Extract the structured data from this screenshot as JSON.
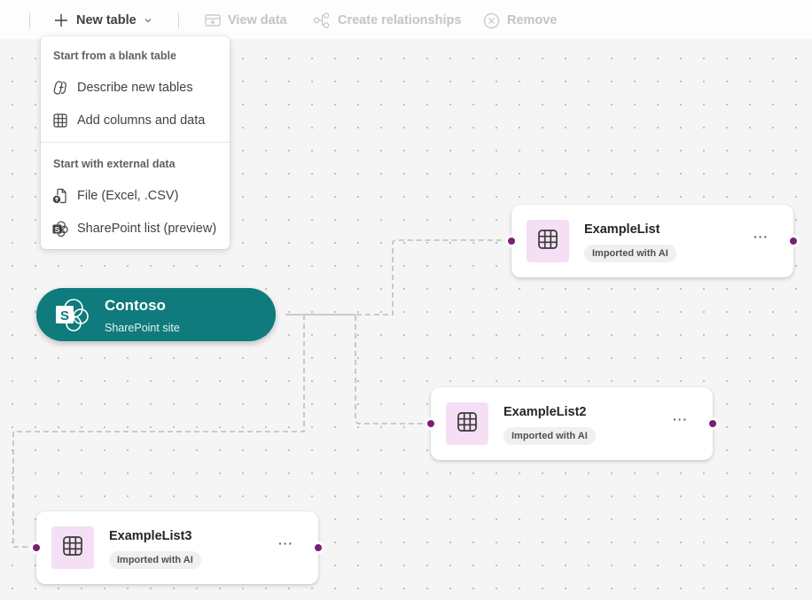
{
  "toolbar": {
    "new_table": {
      "label": "New table",
      "icon": "plus-icon",
      "enabled": true
    },
    "view_data": {
      "label": "View data",
      "icon": "view-data-icon",
      "enabled": false
    },
    "create_relationships": {
      "label": "Create relationships",
      "icon": "relationship-icon",
      "enabled": false
    },
    "remove": {
      "label": "Remove",
      "icon": "dismiss-circle-icon",
      "enabled": false
    }
  },
  "new_table_menu": {
    "sections": [
      {
        "header": "Start from a blank table",
        "items": [
          {
            "label": "Describe new tables",
            "icon": "copilot-icon"
          },
          {
            "label": "Add columns and data",
            "icon": "table-grid-icon"
          }
        ]
      },
      {
        "header": "Start with external data",
        "items": [
          {
            "label": "File (Excel, .CSV)",
            "icon": "file-upload-icon"
          },
          {
            "label": "SharePoint list (preview)",
            "icon": "sharepoint-icon"
          }
        ]
      }
    ]
  },
  "diagram": {
    "source": {
      "title": "Contoso",
      "subtitle": "SharePoint site",
      "icon": "sharepoint-icon",
      "color": "#0f7b7c"
    },
    "tables": [
      {
        "name": "ExampleList",
        "badge": "Imported with AI",
        "more": "···"
      },
      {
        "name": "ExampleList2",
        "badge": "Imported with AI",
        "more": "···"
      },
      {
        "name": "ExampleList3",
        "badge": "Imported with AI",
        "more": "···"
      }
    ],
    "colors": {
      "port": "#7a1f74",
      "table_icon_bg": "#f5dff5",
      "edge": "#bdbdbd"
    }
  }
}
